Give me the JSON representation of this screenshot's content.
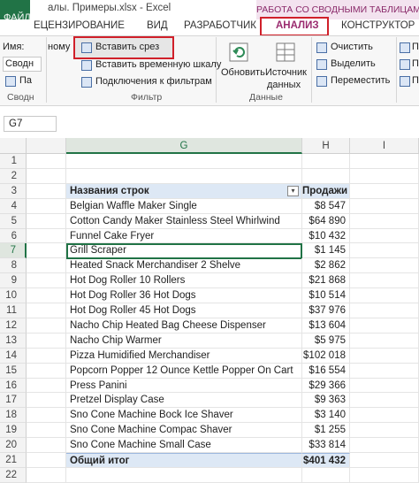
{
  "window": {
    "file_tab": "ФАЙЛ",
    "title": "алы. Примеры.xlsx - Excel",
    "context_title": "РАБОТА СО СВОДНЫМИ ТАБЛИЦАМИ"
  },
  "tabs": {
    "review": "ЕЦЕНЗИРОВАНИЕ",
    "view": "ВИД",
    "developer": "РАЗРАБОТЧИК",
    "analyze": "АНАЛИЗ",
    "design": "КОНСТРУКТОР"
  },
  "ribbon": {
    "name_label": "Имя:",
    "name_value": "Сводн",
    "params_label": "Па",
    "group_pivot_label": "Сводн",
    "nomu": "ному",
    "insert_slicer": "Вставить срез",
    "insert_timeline": "Вставить временную шкалу",
    "filter_connections": "Подключения к фильтрам",
    "group_filter": "Фильтр",
    "refresh": "Обновить",
    "data_source_line1": "Источник",
    "data_source_line2": "данных",
    "group_data": "Данные",
    "clear": "Очистить",
    "select": "Выделить",
    "move": "Переместить",
    "right_cut1": "П",
    "right_cut2": "П",
    "right_cut3": "П"
  },
  "namebox": {
    "value": "G7"
  },
  "columns": {
    "g": "G",
    "h": "H",
    "i": "I"
  },
  "rows": [
    {
      "num": "1",
      "label": "",
      "value": ""
    },
    {
      "num": "2",
      "label": "",
      "value": ""
    },
    {
      "num": "3",
      "label": "Названия строк",
      "value": "Продажи"
    },
    {
      "num": "4",
      "label": "Belgian Waffle Maker Single",
      "value": "$8 547"
    },
    {
      "num": "5",
      "label": "Cotton Candy Maker Stainless Steel Whirlwind",
      "value": "$64 890"
    },
    {
      "num": "6",
      "label": "Funnel Cake Fryer",
      "value": "$10 432"
    },
    {
      "num": "7",
      "label": "Grill Scraper",
      "value": "$1 145"
    },
    {
      "num": "8",
      "label": "Heated Snack Merchandiser 2 Shelve",
      "value": "$2 862"
    },
    {
      "num": "9",
      "label": "Hot Dog Roller 10 Rollers",
      "value": "$21 868"
    },
    {
      "num": "10",
      "label": "Hot Dog Roller 36 Hot Dogs",
      "value": "$10 514"
    },
    {
      "num": "11",
      "label": "Hot Dog Roller 45 Hot Dogs",
      "value": "$37 976"
    },
    {
      "num": "12",
      "label": "Nacho Chip Heated Bag Cheese Dispenser",
      "value": "$13 604"
    },
    {
      "num": "13",
      "label": "Nacho Chip Warmer",
      "value": "$5 975"
    },
    {
      "num": "14",
      "label": "Pizza Humidified Merchandiser",
      "value": "$102 018"
    },
    {
      "num": "15",
      "label": "Popcorn Popper 12 Ounce Kettle Popper On Cart",
      "value": "$16 554"
    },
    {
      "num": "16",
      "label": "Press Panini",
      "value": "$29 366"
    },
    {
      "num": "17",
      "label": "Pretzel Display Case",
      "value": "$9 363"
    },
    {
      "num": "18",
      "label": "Sno Cone Machine Bock Ice Shaver",
      "value": "$3 140"
    },
    {
      "num": "19",
      "label": "Sno Cone Machine Compac Shaver",
      "value": "$1 255"
    },
    {
      "num": "20",
      "label": "Sno Cone Machine Small Case",
      "value": "$33 814"
    },
    {
      "num": "21",
      "label": "Общий итог",
      "value": "$401 432"
    },
    {
      "num": "22",
      "label": "",
      "value": ""
    }
  ],
  "colors": {
    "excel_green": "#217346",
    "highlight_red": "#d0202a",
    "pivot_header_blue": "#dde8f5",
    "context_tab_magenta": "#9a2b6f"
  }
}
